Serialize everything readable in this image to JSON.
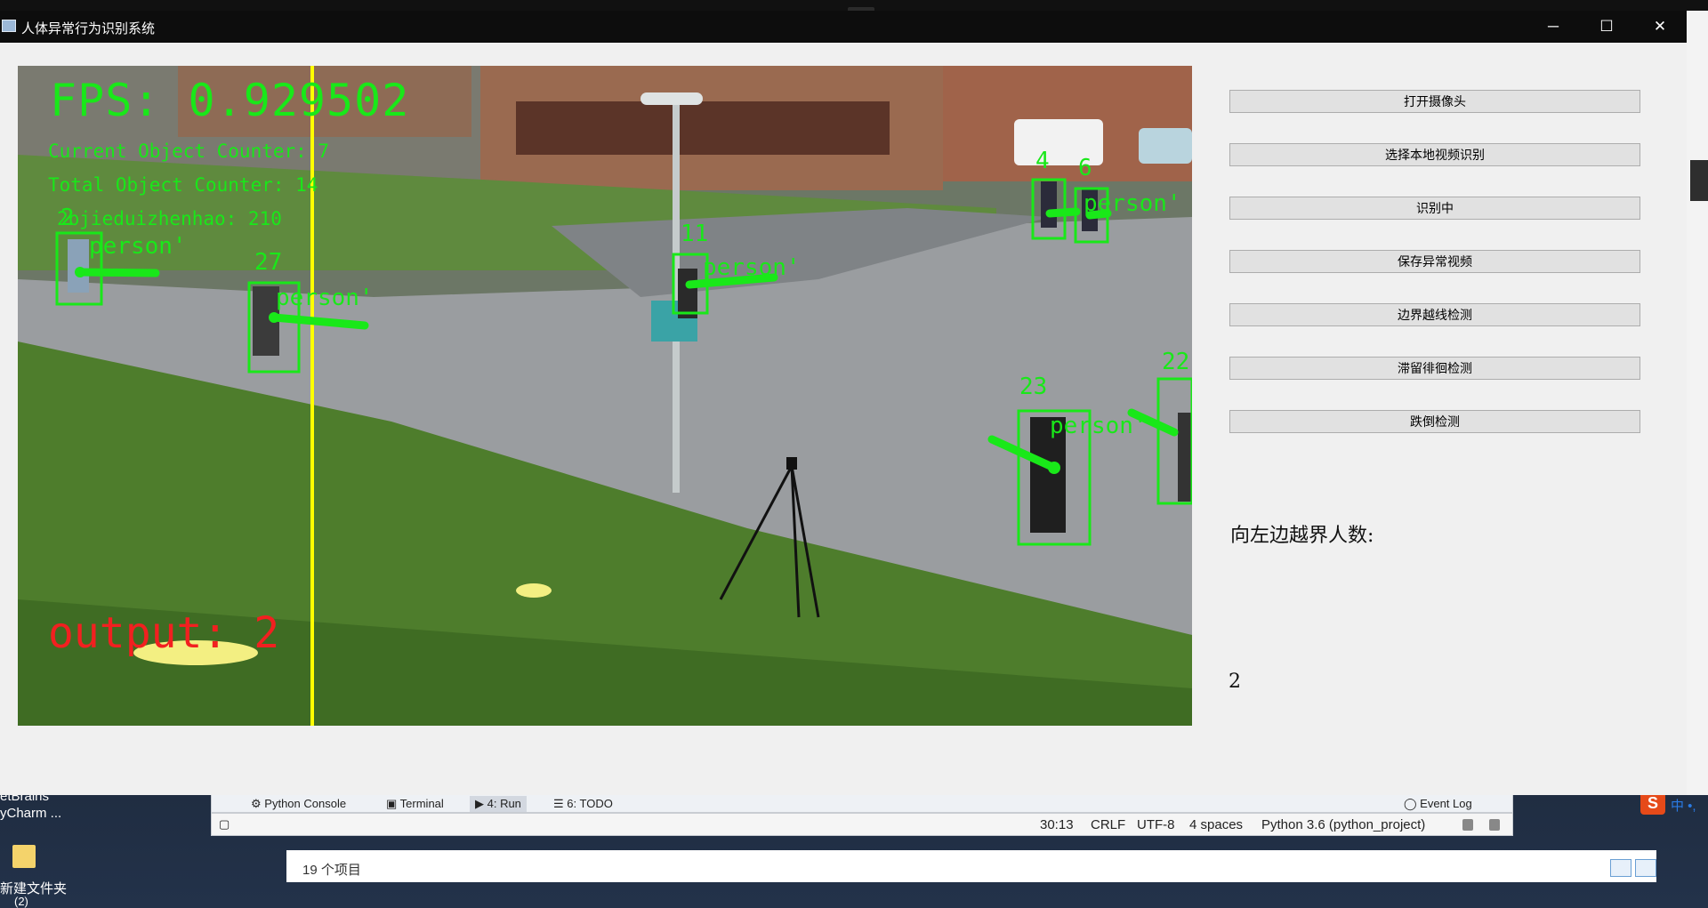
{
  "window": {
    "title": "人体异常行为识别系统",
    "minimize_glyph": "─",
    "maximize_glyph": "☐",
    "close_glyph": "✕"
  },
  "video": {
    "fps_text": "FPS: 0.929502",
    "current_counter": "Current Object Counter: 7",
    "total_counter": "Total Object Counter: 14",
    "bj_text": "2bjieduizhenhao: 210",
    "output_text": "output: 2",
    "track_labels": [
      "2",
      "27",
      "11",
      "4",
      "6",
      "23",
      "22"
    ],
    "class_label": "person'",
    "colors": {
      "box": "#19e819",
      "boundary_line": "#ffff00",
      "output": "#f22020"
    }
  },
  "controls": {
    "buttons": [
      "打开摄像头",
      "选择本地视频识别",
      "识别中",
      "保存异常视频",
      "边界越线检测",
      "滞留徘徊检测",
      "跌倒检测"
    ],
    "left_cross_label": "向左边越界人数:",
    "left_cross_count": "2"
  },
  "ide": {
    "tool_tabs": [
      "Python Console",
      "Terminal",
      "4: Run",
      "6: TODO"
    ],
    "event_log": "Event Log",
    "status": {
      "position": "30:13",
      "line_sep": "CRLF",
      "encoding": "UTF-8",
      "indent": "4 spaces",
      "interpreter": "Python 3.6 (python_project)"
    }
  },
  "desktop": {
    "jetbrains": "etBrains",
    "pycharm": "yCharm ...",
    "folder": "新建文件夹",
    "folder_sub": "(2)",
    "explorer_count": "19 个项目",
    "ime_label": "中 •,"
  }
}
